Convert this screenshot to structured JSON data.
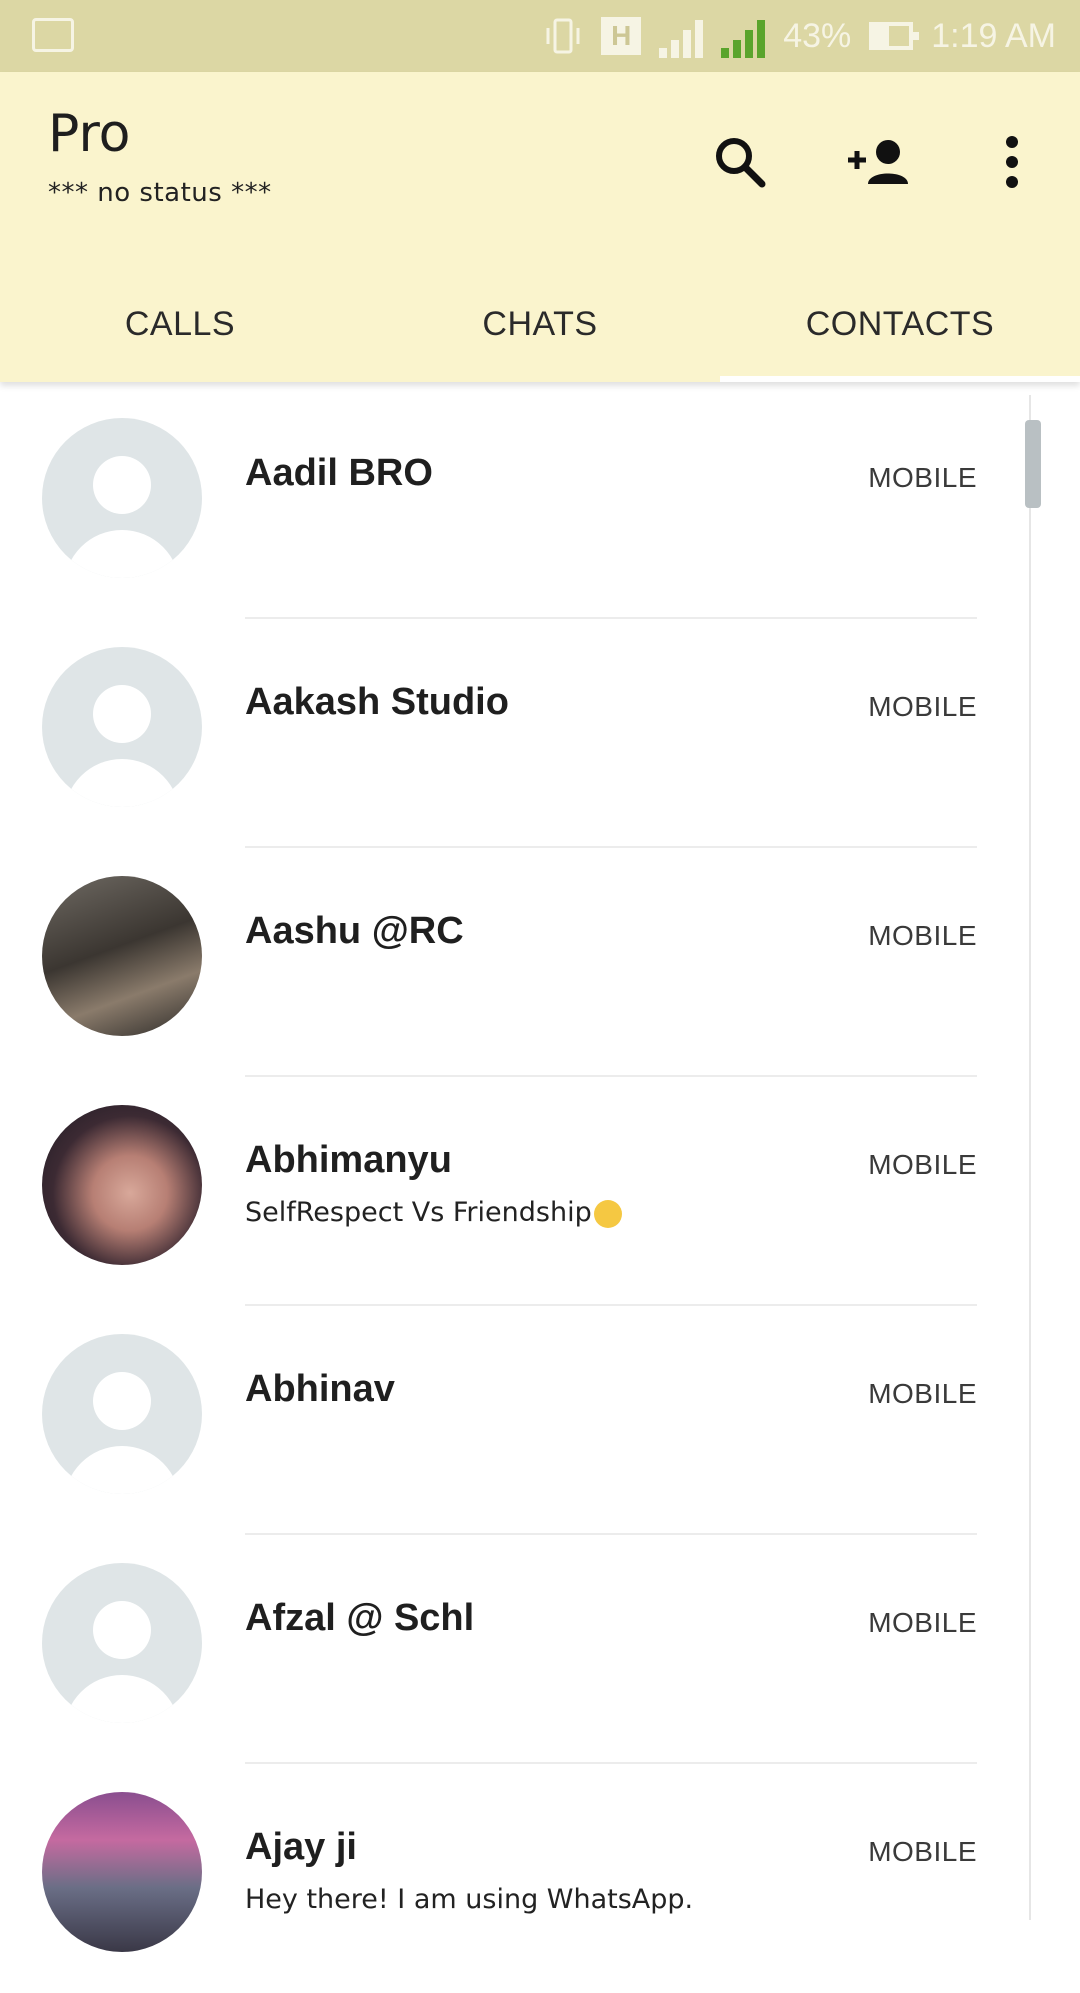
{
  "status_bar": {
    "network_type": "H",
    "sim1": "1",
    "sim2": "2",
    "battery": "43%",
    "time": "1:19 AM"
  },
  "header": {
    "title": "Pro",
    "status": "*** no status ***",
    "icons": [
      "search-icon",
      "add-contact-icon",
      "more-vert-icon"
    ]
  },
  "tabs": [
    {
      "label": "CALLS",
      "active": false
    },
    {
      "label": "CHATS",
      "active": false
    },
    {
      "label": "CONTACTS",
      "active": true
    }
  ],
  "contacts": [
    {
      "name": "Aadil BRO",
      "status": "",
      "type": "MOBILE"
    },
    {
      "name": "Aakash Studio",
      "status": "",
      "type": "MOBILE"
    },
    {
      "name": "Aashu @RC",
      "status": "",
      "type": "MOBILE"
    },
    {
      "name": "Abhimanyu",
      "status": "SelfRespect Vs Friendship",
      "type": "MOBILE"
    },
    {
      "name": "Abhinav",
      "status": "",
      "type": "MOBILE"
    },
    {
      "name": "Afzal @ Schl",
      "status": "",
      "type": "MOBILE"
    },
    {
      "name": "Ajay ji",
      "status": "Hey there! I am using WhatsApp.",
      "type": "MOBILE"
    }
  ],
  "colors": {
    "status_bar_bg": "#dcd7a4",
    "app_bar_bg": "#faf4cd",
    "signal_green": "#5aa42c"
  }
}
